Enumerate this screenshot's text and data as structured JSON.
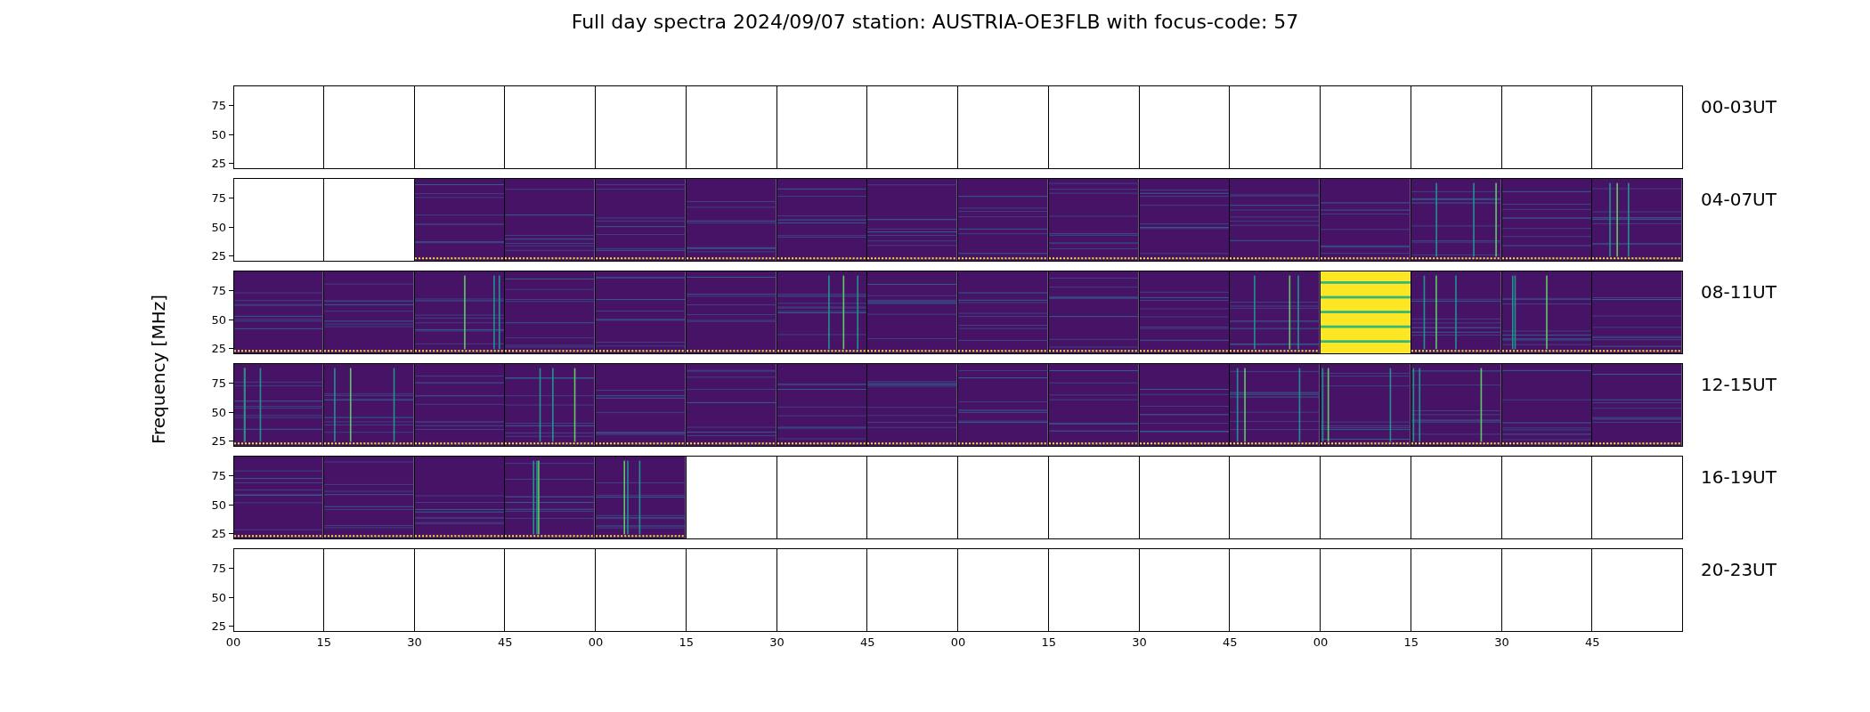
{
  "title": "Full day spectra 2024/09/07 station: AUSTRIA-OE3FLB with focus-code: 57",
  "ylabel": "Frequency [MHz]",
  "rows": [
    {
      "label": "00-03UT",
      "yticks": [
        "75",
        "50",
        "25"
      ],
      "panels": [
        {
          "kind": "empty"
        },
        {
          "kind": "empty"
        },
        {
          "kind": "empty"
        },
        {
          "kind": "empty"
        },
        {
          "kind": "empty"
        },
        {
          "kind": "empty"
        },
        {
          "kind": "empty"
        },
        {
          "kind": "empty"
        },
        {
          "kind": "empty"
        },
        {
          "kind": "empty"
        },
        {
          "kind": "empty"
        },
        {
          "kind": "empty"
        },
        {
          "kind": "empty"
        },
        {
          "kind": "empty"
        },
        {
          "kind": "empty"
        },
        {
          "kind": "empty"
        }
      ]
    },
    {
      "label": "04-07UT",
      "yticks": [
        "75",
        "50",
        "25"
      ],
      "panels": [
        {
          "kind": "empty"
        },
        {
          "kind": "empty"
        },
        {
          "kind": "spectrum"
        },
        {
          "kind": "spectrum"
        },
        {
          "kind": "spectrum"
        },
        {
          "kind": "spectrum"
        },
        {
          "kind": "spectrum"
        },
        {
          "kind": "spectrum"
        },
        {
          "kind": "spectrum"
        },
        {
          "kind": "spectrum"
        },
        {
          "kind": "spectrum"
        },
        {
          "kind": "spectrum"
        },
        {
          "kind": "spectrum"
        },
        {
          "kind": "spectrum"
        },
        {
          "kind": "spectrum"
        },
        {
          "kind": "spectrum"
        }
      ]
    },
    {
      "label": "08-11UT",
      "yticks": [
        "75",
        "50",
        "25"
      ],
      "panels": [
        {
          "kind": "spectrum"
        },
        {
          "kind": "spectrum"
        },
        {
          "kind": "spectrum"
        },
        {
          "kind": "spectrum"
        },
        {
          "kind": "spectrum"
        },
        {
          "kind": "spectrum"
        },
        {
          "kind": "spectrum"
        },
        {
          "kind": "spectrum"
        },
        {
          "kind": "spectrum"
        },
        {
          "kind": "spectrum"
        },
        {
          "kind": "spectrum"
        },
        {
          "kind": "spectrum"
        },
        {
          "kind": "saturated"
        },
        {
          "kind": "spectrum"
        },
        {
          "kind": "spectrum"
        },
        {
          "kind": "spectrum"
        }
      ]
    },
    {
      "label": "12-15UT",
      "yticks": [
        "75",
        "50",
        "25"
      ],
      "panels": [
        {
          "kind": "spectrum"
        },
        {
          "kind": "spectrum"
        },
        {
          "kind": "spectrum"
        },
        {
          "kind": "spectrum"
        },
        {
          "kind": "spectrum"
        },
        {
          "kind": "spectrum"
        },
        {
          "kind": "spectrum"
        },
        {
          "kind": "spectrum"
        },
        {
          "kind": "spectrum"
        },
        {
          "kind": "spectrum"
        },
        {
          "kind": "spectrum"
        },
        {
          "kind": "spectrum"
        },
        {
          "kind": "spectrum"
        },
        {
          "kind": "spectrum"
        },
        {
          "kind": "spectrum"
        },
        {
          "kind": "spectrum"
        }
      ]
    },
    {
      "label": "16-19UT",
      "yticks": [
        "75",
        "50",
        "25"
      ],
      "panels": [
        {
          "kind": "spectrum"
        },
        {
          "kind": "spectrum"
        },
        {
          "kind": "spectrum"
        },
        {
          "kind": "spectrum"
        },
        {
          "kind": "spectrum"
        },
        {
          "kind": "empty"
        },
        {
          "kind": "empty"
        },
        {
          "kind": "empty"
        },
        {
          "kind": "empty"
        },
        {
          "kind": "empty"
        },
        {
          "kind": "empty"
        },
        {
          "kind": "empty"
        },
        {
          "kind": "empty"
        },
        {
          "kind": "empty"
        },
        {
          "kind": "empty"
        },
        {
          "kind": "empty"
        }
      ]
    },
    {
      "label": "20-23UT",
      "yticks": [
        "75",
        "50",
        "25"
      ],
      "panels": [
        {
          "kind": "empty"
        },
        {
          "kind": "empty"
        },
        {
          "kind": "empty"
        },
        {
          "kind": "empty"
        },
        {
          "kind": "empty"
        },
        {
          "kind": "empty"
        },
        {
          "kind": "empty"
        },
        {
          "kind": "empty"
        },
        {
          "kind": "empty"
        },
        {
          "kind": "empty"
        },
        {
          "kind": "empty"
        },
        {
          "kind": "empty"
        },
        {
          "kind": "empty"
        },
        {
          "kind": "empty"
        },
        {
          "kind": "empty"
        },
        {
          "kind": "empty"
        }
      ]
    }
  ],
  "xticks": [
    "00",
    "15",
    "30",
    "45",
    "00",
    "15",
    "30",
    "45",
    "00",
    "15",
    "30",
    "45",
    "00",
    "15",
    "30",
    "45"
  ]
}
